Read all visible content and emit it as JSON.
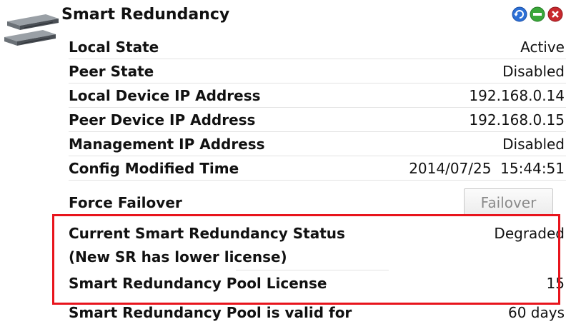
{
  "panel": {
    "title": "Smart Redundancy",
    "icons": [
      "refresh-icon",
      "expand-icon",
      "close-icon"
    ],
    "rows": [
      {
        "label": "Local State",
        "value": "Active"
      },
      {
        "label": "Peer State",
        "value": "Disabled"
      },
      {
        "label": "Local Device IP Address",
        "value": "192.168.0.14"
      },
      {
        "label": "Peer Device IP Address",
        "value": "192.168.0.15"
      },
      {
        "label": "Management IP Address",
        "value": "Disabled"
      },
      {
        "label": "Config Modified Time",
        "value": "2014/07/25  15:44:51"
      }
    ],
    "failover": {
      "label": "Force Failover",
      "button": "Failover"
    },
    "status_rows": [
      {
        "label": "Current Smart Redundancy Status",
        "value": "Degraded"
      },
      {
        "label": "(New SR has lower license)",
        "value": ""
      },
      {
        "label": "Smart Redundancy Pool License",
        "value": "15"
      },
      {
        "label": "Smart Redundancy Pool is valid for",
        "value": "60 days"
      }
    ]
  },
  "colors": {
    "highlight": "#e8141c",
    "icon_blue": "#2b6fd6",
    "icon_green": "#3aa83a",
    "icon_red": "#c8282d"
  }
}
